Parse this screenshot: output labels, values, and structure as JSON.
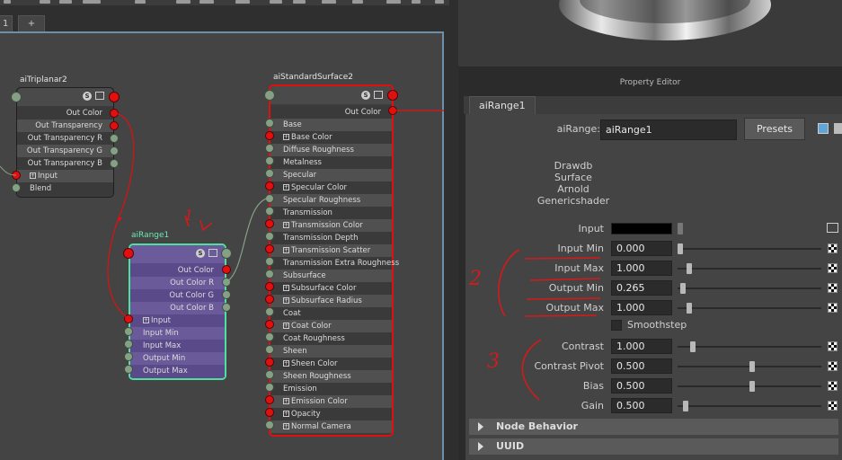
{
  "tabs": {
    "first": "1",
    "add": "+"
  },
  "nodes": {
    "triplanar": {
      "title": "aiTriplanar2",
      "rows": [
        "Out Color",
        "Out Transparency",
        "Out Transparency R",
        "Out Transparency G",
        "Out Transparency B",
        "Input",
        "Blend"
      ]
    },
    "range": {
      "title": "aiRange1",
      "rows": [
        "Out Color",
        "Out Color R",
        "Out Color G",
        "Out Color B",
        "Input",
        "Input Min",
        "Input Max",
        "Output Min",
        "Output Max"
      ]
    },
    "standard": {
      "title": "aiStandardSurface2",
      "out": "Out Color",
      "rows": [
        "Base",
        "Base Color",
        "Diffuse Roughness",
        "Metalness",
        "Specular",
        "Specular Color",
        "Specular Roughness",
        "Transmission",
        "Transmission Color",
        "Transmission Depth",
        "Transmission Scatter",
        "Transmission Extra Roughness",
        "Subsurface",
        "Subsurface Color",
        "Subsurface Radius",
        "Coat",
        "Coat Color",
        "Coat Roughness",
        "Sheen",
        "Sheen Color",
        "Sheen Roughness",
        "Emission",
        "Emission Color",
        "Opacity",
        "Normal Camera"
      ]
    }
  },
  "badge": "S",
  "property_editor": {
    "title": "Property Editor",
    "tab": "aiRange1",
    "node_type_label": "aiRange:",
    "node_name": "aiRange1",
    "presets": "Presets",
    "description": [
      "Drawdb",
      "Surface",
      "Arnold",
      "Genericshader"
    ],
    "input_label": "Input",
    "input_color": "#000000",
    "attrs": [
      {
        "label": "Input Min",
        "value": "0.000",
        "slider": 0.0
      },
      {
        "label": "Input Max",
        "value": "1.000",
        "slider": 0.06
      },
      {
        "label": "Output Min",
        "value": "0.265",
        "slider": 0.02
      },
      {
        "label": "Output Max",
        "value": "1.000",
        "slider": 0.06
      }
    ],
    "smoothstep": "Smoothstep",
    "attrs2": [
      {
        "label": "Contrast",
        "value": "1.000",
        "slider": 0.09
      },
      {
        "label": "Contrast Pivot",
        "value": "0.500",
        "slider": 0.5
      },
      {
        "label": "Bias",
        "value": "0.500",
        "slider": 0.5
      },
      {
        "label": "Gain",
        "value": "0.500",
        "slider": 0.04
      }
    ],
    "sections": [
      "Node Behavior",
      "UUID"
    ]
  },
  "annotations": {
    "a1": "1",
    "a2": "2",
    "a3": "3"
  },
  "colors": {
    "accent_red": "#e01010",
    "node_purple": "#5a4a8a",
    "node_select": "#4fe0a0"
  }
}
